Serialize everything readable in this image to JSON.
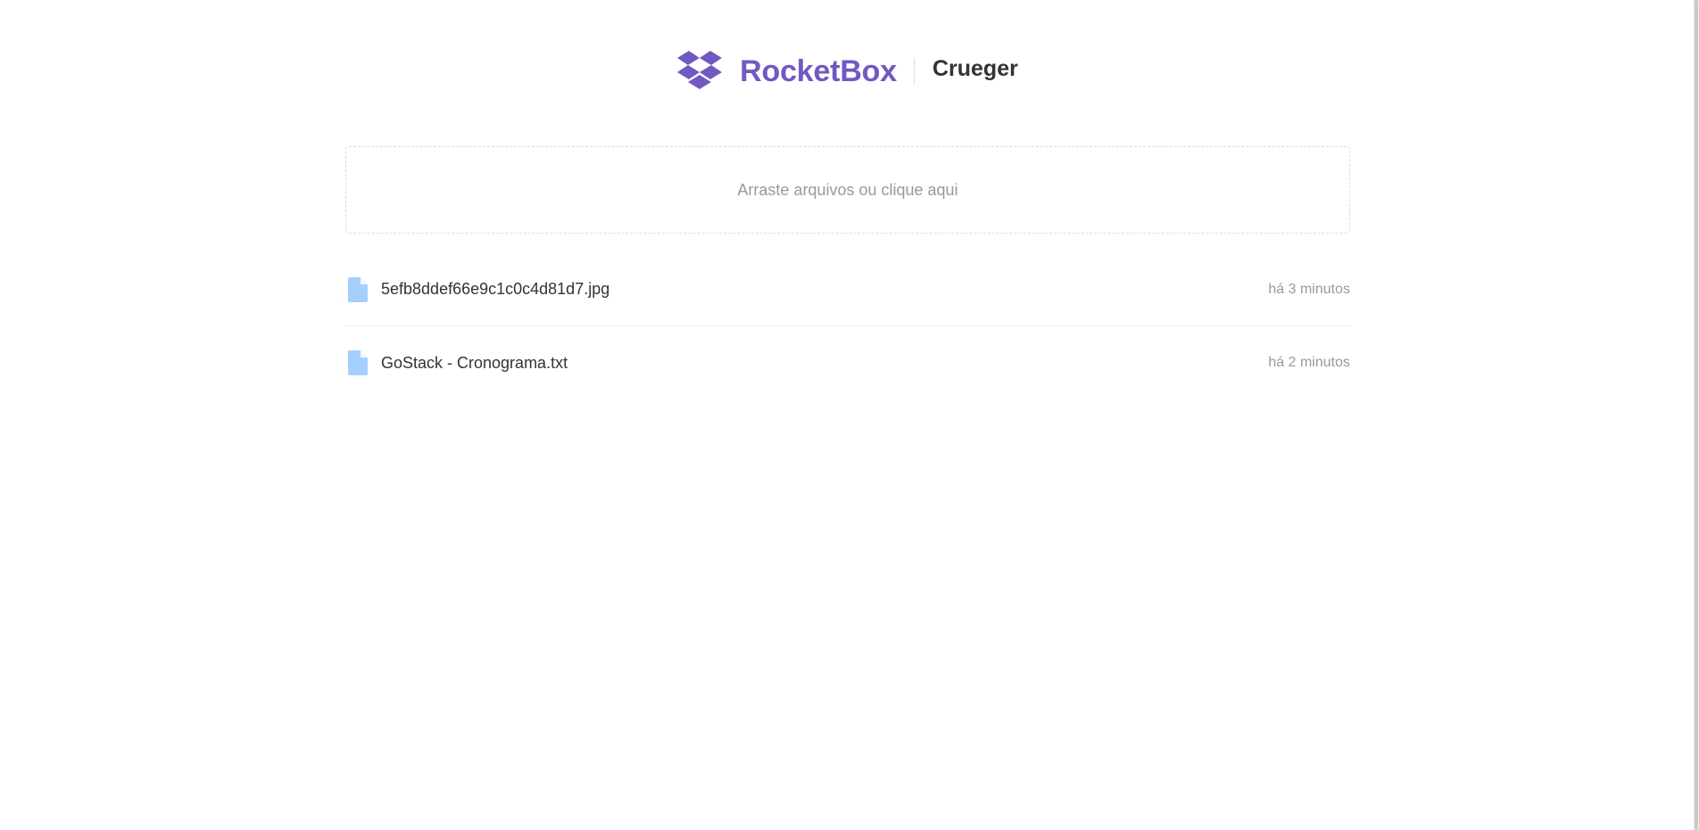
{
  "header": {
    "logo_icon": "dropbox-box-icon",
    "brand_name": "RocketBox",
    "box_title": "Crueger"
  },
  "dropzone": {
    "label": "Arraste arquivos ou clique aqui"
  },
  "files": [
    {
      "icon": "file-icon",
      "name": "5efb8ddef66e9c1c0c4d81d7.jpg",
      "time": "há 3 minutos"
    },
    {
      "icon": "file-icon",
      "name": "GoStack - Cronograma.txt",
      "time": "há 2 minutos"
    }
  ],
  "colors": {
    "brand": "#7159c1",
    "file_icon": "#a5cfff",
    "text": "#333333",
    "muted": "#999999",
    "border": "#dddddd"
  }
}
